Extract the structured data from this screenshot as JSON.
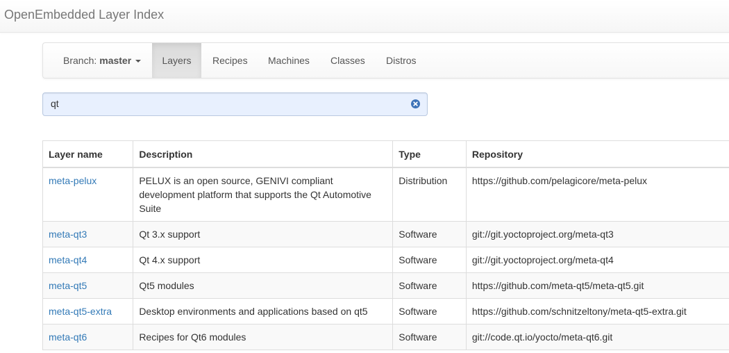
{
  "header": {
    "brand": "OpenEmbedded Layer Index"
  },
  "nav": {
    "branch_label": "Branch:",
    "branch_value": "master",
    "tabs": [
      {
        "label": "Layers",
        "active": true
      },
      {
        "label": "Recipes",
        "active": false
      },
      {
        "label": "Machines",
        "active": false
      },
      {
        "label": "Classes",
        "active": false
      },
      {
        "label": "Distros",
        "active": false
      }
    ]
  },
  "search": {
    "value": "qt",
    "clear_icon": "clear-circle-icon"
  },
  "table": {
    "columns": [
      "Layer name",
      "Description",
      "Type",
      "Repository"
    ],
    "rows": [
      {
        "name": "meta-pelux",
        "description": "PELUX is an open source, GENIVI compliant development platform that supports the Qt Automotive Suite",
        "type": "Distribution",
        "repository": "https://github.com/pelagicore/meta-pelux"
      },
      {
        "name": "meta-qt3",
        "description": "Qt 3.x support",
        "type": "Software",
        "repository": "git://git.yoctoproject.org/meta-qt3"
      },
      {
        "name": "meta-qt4",
        "description": "Qt 4.x support",
        "type": "Software",
        "repository": "git://git.yoctoproject.org/meta-qt4"
      },
      {
        "name": "meta-qt5",
        "description": "Qt5 modules",
        "type": "Software",
        "repository": "https://github.com/meta-qt5/meta-qt5.git"
      },
      {
        "name": "meta-qt5-extra",
        "description": "Desktop environments and applications based on qt5",
        "type": "Software",
        "repository": "https://github.com/schnitzeltony/meta-qt5-extra.git"
      },
      {
        "name": "meta-qt6",
        "description": "Recipes for Qt6 modules",
        "type": "Software",
        "repository": "git://code.qt.io/yocto/meta-qt6.git"
      }
    ]
  },
  "colors": {
    "link": "#337ab7",
    "active_tab_bg": "#e0e0e0",
    "search_bg": "#e8f0fe",
    "clear_icon": "#3d73b8"
  }
}
